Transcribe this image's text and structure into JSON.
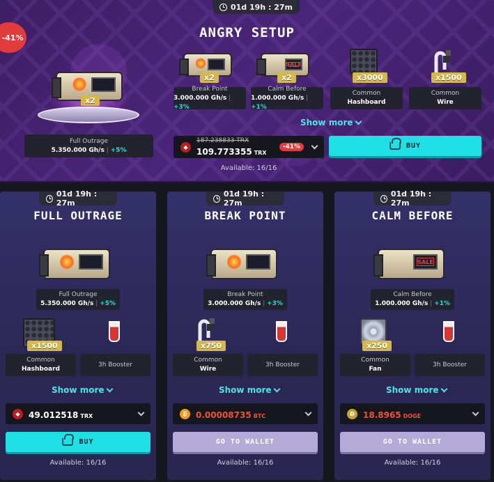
{
  "featured": {
    "timer": "01d 19h : 27m",
    "discount_badge": "-41%",
    "title": "ANGRY SETUP",
    "main_item": {
      "qty": "x2",
      "name": "Full Outrage",
      "power": "5.350.000 Gh/s",
      "bonus": "+5%"
    },
    "items": [
      {
        "qty": "x2",
        "name": "Break Point",
        "power": "3.000.000 Gh/s",
        "bonus": "+3%",
        "icon": "miner-rig-icon"
      },
      {
        "qty": "x2",
        "name": "Calm Before",
        "power": "1.000.000 Gh/s",
        "bonus": "+1%",
        "icon": "miner-rig-icon"
      },
      {
        "qty": "x3000",
        "name": "Common",
        "type": "Hashboard",
        "icon": "hashboard-icon"
      },
      {
        "qty": "x1500",
        "name": "Common",
        "type": "Wire",
        "icon": "wire-icon"
      }
    ],
    "show_more": "Show more",
    "price": {
      "old": "187.238833 TRX",
      "value": "109.773355",
      "currency": "TRX",
      "discount": "-41%"
    },
    "buy_label": "BUY",
    "available": "Available: 16/16"
  },
  "cards": [
    {
      "timer": "01d 19h : 27m",
      "title": "FULL OUTRAGE",
      "miner": {
        "name": "Full Outrage",
        "power": "5.350.000 Gh/s",
        "bonus": "+5%"
      },
      "items": [
        {
          "qty": "x1500",
          "name": "Common",
          "type": "Hashboard"
        },
        {
          "name": "3h Booster"
        }
      ],
      "show_more": "Show more",
      "price": {
        "value": "49.012518",
        "currency": "TRX",
        "coin": "trx",
        "color": "#ffffff"
      },
      "action_label": "BUY",
      "available": "Available: 16/16"
    },
    {
      "timer": "01d 19h : 27m",
      "title": "BREAK POINT",
      "miner": {
        "name": "Break Point",
        "power": "3.000.000 Gh/s",
        "bonus": "+3%"
      },
      "items": [
        {
          "qty": "x750",
          "name": "Common",
          "type": "Wire"
        },
        {
          "name": "3h Booster"
        }
      ],
      "show_more": "Show more",
      "price": {
        "value": "0.00008735",
        "currency": "BTC",
        "coin": "btc",
        "color": "#f0532f"
      },
      "action_label": "GO TO WALLET",
      "available": "Available: 16/16"
    },
    {
      "timer": "01d 19h : 27m",
      "title": "CALM BEFORE",
      "miner": {
        "name": "Calm Before",
        "power": "1.000.000 Gh/s",
        "bonus": "+1%"
      },
      "items": [
        {
          "qty": "x250",
          "name": "Common",
          "type": "Fan"
        },
        {
          "name": "3h Booster"
        }
      ],
      "show_more": "Show more",
      "price": {
        "value": "18.8965",
        "currency": "DOGE",
        "coin": "doge",
        "color": "#f0532f"
      },
      "action_label": "GO TO WALLET",
      "available": "Available: 16/16"
    }
  ],
  "colors": {
    "accent": "#1fe0e4",
    "discount": "#e23b3b",
    "bonus": "#2fd9d6",
    "banner": "#4b2579",
    "card": "#2f2b5e"
  }
}
